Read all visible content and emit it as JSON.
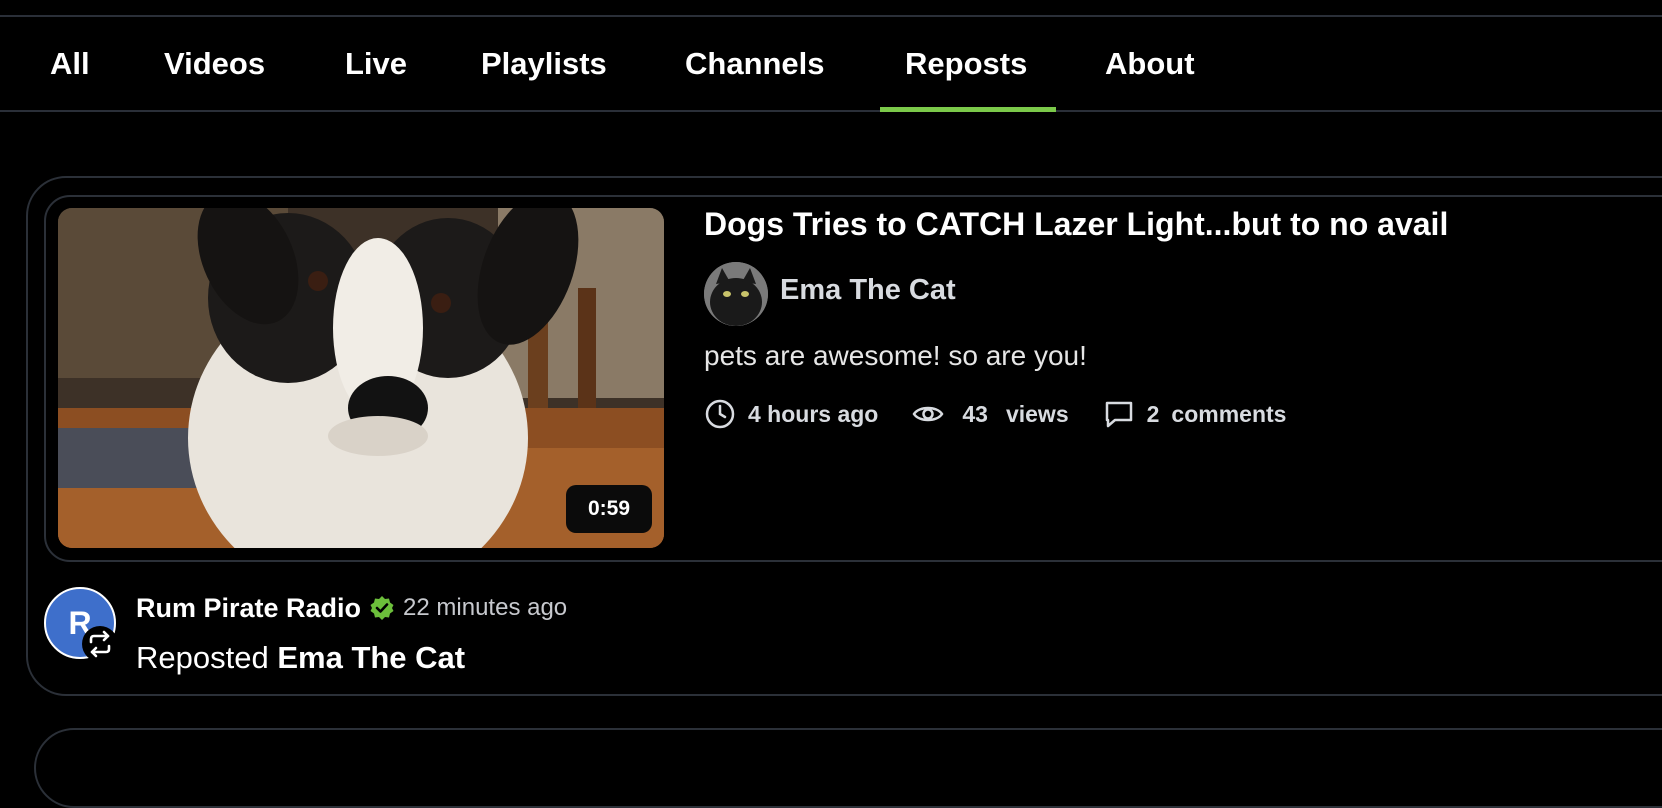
{
  "tabs": [
    {
      "label": "All",
      "active": false
    },
    {
      "label": "Videos",
      "active": false
    },
    {
      "label": "Live",
      "active": false
    },
    {
      "label": "Playlists",
      "active": false
    },
    {
      "label": "Channels",
      "active": false
    },
    {
      "label": "Reposts",
      "active": true
    },
    {
      "label": "About",
      "active": false
    }
  ],
  "colors": {
    "accent": "#7bc94a",
    "avatar_bg": "#3e6fcb",
    "border": "#2b3038",
    "background": "#000000"
  },
  "video": {
    "title": "Dogs Tries to CATCH Lazer Light...but to no avail",
    "duration": "0:59",
    "thumbnail_icon": "dog-photo",
    "channel_name": "Ema The Cat",
    "channel_avatar_icon": "black-cat-avatar",
    "description": "pets are awesome! so are you!",
    "time_ago": "4 hours ago",
    "views_count": "43",
    "views_label": "views",
    "comments_count": "2",
    "comments_label": "comments"
  },
  "repost": {
    "reposter_name": "Rum Pirate Radio",
    "avatar_letter": "R",
    "verified_icon": "verified-check-icon",
    "time_ago": "22 minutes ago",
    "action_label": "Reposted",
    "original_channel": "Ema The Cat"
  }
}
